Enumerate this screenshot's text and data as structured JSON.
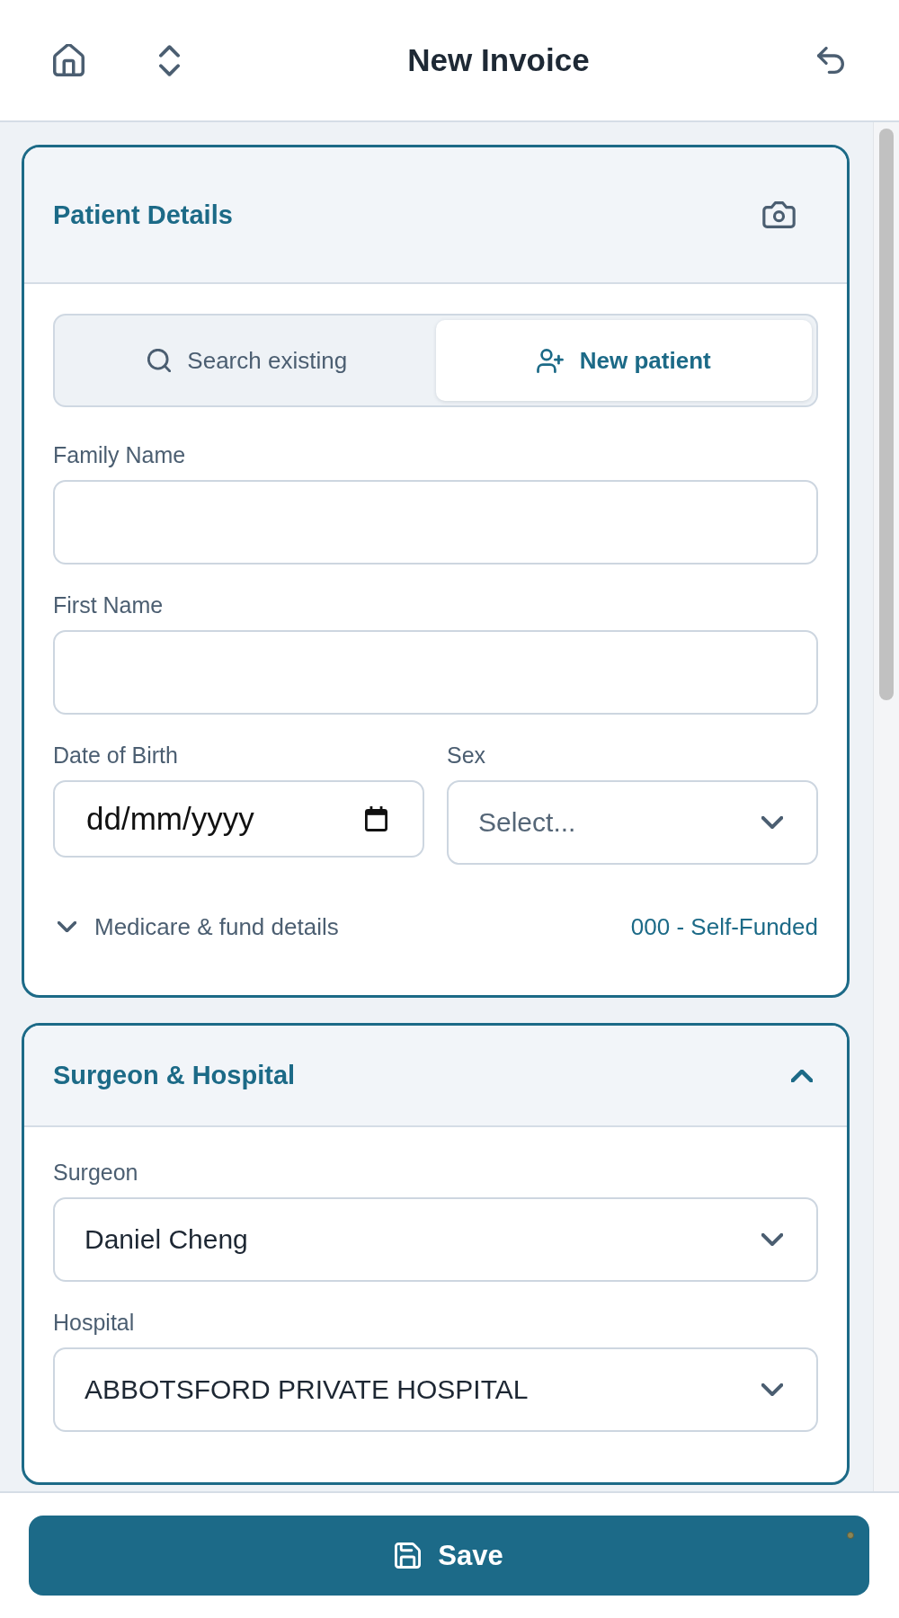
{
  "header": {
    "title": "New Invoice"
  },
  "patient_details": {
    "title": "Patient Details",
    "mode_tabs": [
      {
        "label": "Search existing",
        "kind": "search",
        "selected": false
      },
      {
        "label": "New patient",
        "kind": "add",
        "selected": true
      }
    ],
    "field_rows": [
      {
        "fields": [
          {
            "label": "Family Name",
            "kind": "text"
          }
        ]
      },
      {
        "fields": [
          {
            "label": "First Name",
            "kind": "text"
          }
        ]
      },
      {
        "fields": [
          {
            "label": "Date of Birth",
            "kind": "date",
            "placeholder": "dd/mm/yyyy"
          },
          {
            "label": "Sex",
            "kind": "select",
            "placeholder": "Select..."
          }
        ]
      }
    ],
    "fund_details": {
      "label": "Medicare & fund details",
      "expanded": false,
      "summary": "000 - Self-Funded"
    }
  },
  "surgeon_hospital": {
    "title": "Surgeon & Hospital",
    "expanded": true,
    "fields": [
      {
        "label": "Surgeon",
        "kind": "select",
        "value": "Daniel Cheng"
      },
      {
        "label": "Hospital",
        "kind": "select",
        "value": "ABBOTSFORD PRIVATE HOSPITAL"
      }
    ]
  },
  "footer": {
    "save_button": {
      "label": "Save"
    }
  }
}
